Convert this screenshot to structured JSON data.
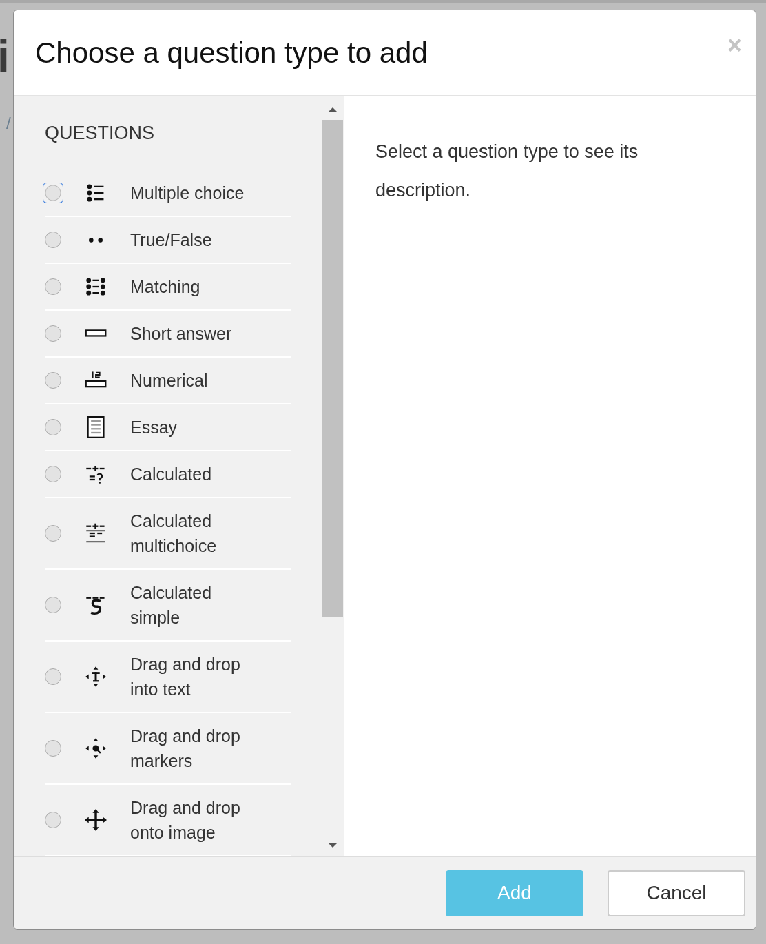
{
  "backdrop": {
    "fragments": [
      "i",
      "/"
    ]
  },
  "dialog": {
    "title": "Choose a question type to add",
    "close": "×"
  },
  "questions": {
    "heading": "QUESTIONS",
    "items": [
      {
        "label": "Multiple choice",
        "selected": false,
        "focused": true
      },
      {
        "label": "True/False",
        "selected": false,
        "focused": false
      },
      {
        "label": "Matching",
        "selected": false,
        "focused": false
      },
      {
        "label": "Short answer",
        "selected": false,
        "focused": false
      },
      {
        "label": "Numerical",
        "selected": false,
        "focused": false
      },
      {
        "label": "Essay",
        "selected": false,
        "focused": false
      },
      {
        "label": "Calculated",
        "selected": false,
        "focused": false
      },
      {
        "label": "Calculated multichoice",
        "selected": false,
        "focused": false
      },
      {
        "label": "Calculated simple",
        "selected": false,
        "focused": false
      },
      {
        "label": "Drag and drop into text",
        "selected": false,
        "focused": false
      },
      {
        "label": "Drag and drop markers",
        "selected": false,
        "focused": false
      },
      {
        "label": "Drag and drop onto image",
        "selected": false,
        "focused": false
      }
    ]
  },
  "description": "Select a question type to see its description.",
  "buttons": [
    {
      "label": "Add",
      "kind": "primary"
    },
    {
      "label": "Cancel",
      "kind": "secondary"
    }
  ]
}
